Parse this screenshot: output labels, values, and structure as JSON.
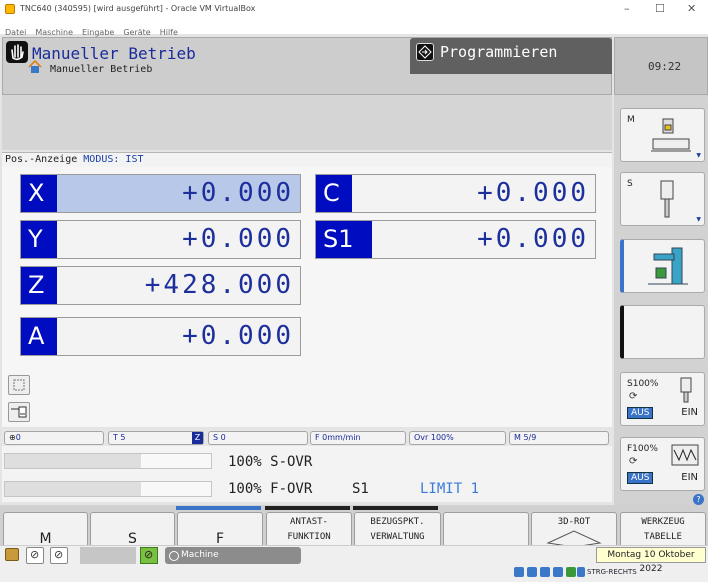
{
  "window": {
    "title": "TNC640 (340595) [wird ausgeführt] - Oracle VM VirtualBox",
    "menu": [
      "Datei",
      "Maschine",
      "Eingabe",
      "Geräte",
      "Hilfe"
    ],
    "controls": [
      "–",
      "☐",
      "✕"
    ]
  },
  "header": {
    "mode_main": "Manueller Betrieb",
    "mode_sub": "Manueller Betrieb",
    "program_tab": "Programmieren",
    "clock": "09:22"
  },
  "pos_display": {
    "label": "Pos.-Anzeige",
    "mode_label": "MODUS: IST"
  },
  "axes": [
    {
      "letter": "X",
      "value": "+0.000"
    },
    {
      "letter": "Y",
      "value": "+0.000"
    },
    {
      "letter": "Z",
      "value": "+428.000"
    },
    {
      "letter": "A",
      "value": "+0.000"
    },
    {
      "letter": "C",
      "value": "+0.000"
    },
    {
      "letter": "S1",
      "value": "+0.000"
    }
  ],
  "status": {
    "tool_no": "0",
    "tool": "T 5",
    "z_flag": "Z",
    "spindle": "S 0",
    "feed": "F 0mm/min",
    "ovr": "Ovr 100%",
    "m": "M 5/9"
  },
  "overrides": {
    "s_ovr": "100% S-OVR",
    "f_ovr": "100% F-OVR",
    "s1": "S1",
    "limit": "LIMIT 1",
    "s_fill": 0.66,
    "f_fill": 0.66
  },
  "right_softkeys": {
    "m": "M",
    "s": "S",
    "s_ovr_label": "S100%",
    "s_aus": "AUS",
    "s_ein": "EIN",
    "f_ovr_label": "F100%",
    "f_aus": "AUS",
    "f_ein": "EIN"
  },
  "bottom_softkeys": [
    {
      "line1": "M",
      "line2": ""
    },
    {
      "line1": "S",
      "line2": ""
    },
    {
      "line1": "F",
      "line2": ""
    },
    {
      "line1": "ANTAST-",
      "line2": "FUNKTION"
    },
    {
      "line1": "BEZUGSPKT.",
      "line2": "VERWALTUNG"
    },
    {
      "line1": "",
      "line2": ""
    },
    {
      "line1": "3D-ROT",
      "line2": ""
    },
    {
      "line1": "WERKZEUG",
      "line2": "TABELLE"
    }
  ],
  "taskbar": {
    "machine": "Machine",
    "date": "Montag 10 Oktober 2022",
    "hostkey": "STRG-RECHTS"
  }
}
